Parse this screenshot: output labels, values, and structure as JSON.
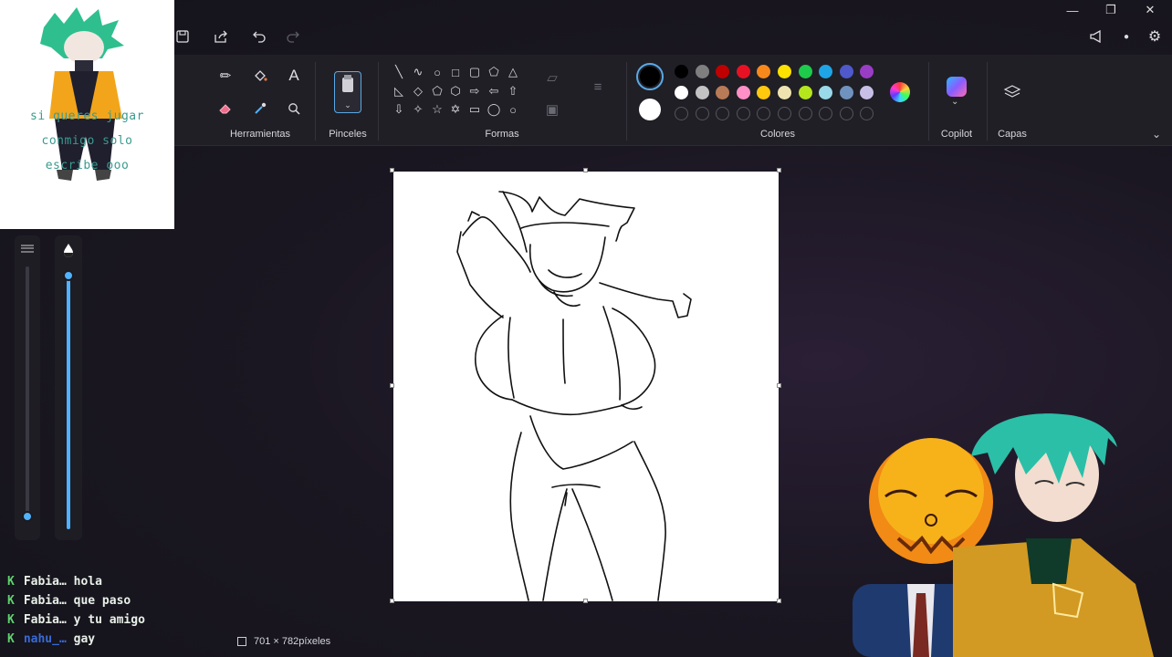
{
  "window": {
    "minimize_glyph": "—",
    "restore_glyph": "❐",
    "close_glyph": "✕"
  },
  "ribbon": {
    "groups": {
      "tools": "Herramientas",
      "brushes": "Pinceles",
      "shapes": "Formas",
      "colors": "Colores",
      "copilot": "Copilot",
      "layers": "Capas"
    },
    "palette_row1": [
      "#000000",
      "#7f7f7f",
      "#c00000",
      "#e81123",
      "#f7891c",
      "#fde100",
      "#1ecb4b",
      "#1fa5e6",
      "#4f59cc",
      "#9a3dc5"
    ],
    "palette_row2": [
      "#ffffff",
      "#c3c3c3",
      "#b97a57",
      "#ff8fc7",
      "#ffc90e",
      "#efe4b0",
      "#b5e61d",
      "#99d9ea",
      "#7092be",
      "#c8bfe7"
    ],
    "primary_color": "#000000",
    "secondary_color": "#ffffff"
  },
  "canvas": {
    "size_text": "701 × 782píxeles"
  },
  "overlay": {
    "line1": "si queres jugar",
    "line2": "conmigo solo",
    "line3": "escribe ooo"
  },
  "chat": [
    {
      "user": "Fabia…",
      "message": "hola"
    },
    {
      "user": "Fabia…",
      "message": "que paso"
    },
    {
      "user": "Fabia…",
      "message": "y tu amigo"
    },
    {
      "user": "nahu_…",
      "message": "gay"
    }
  ],
  "icons": {
    "save": "save-icon",
    "share": "share-icon",
    "undo": "undo-icon",
    "redo": "redo-icon"
  }
}
